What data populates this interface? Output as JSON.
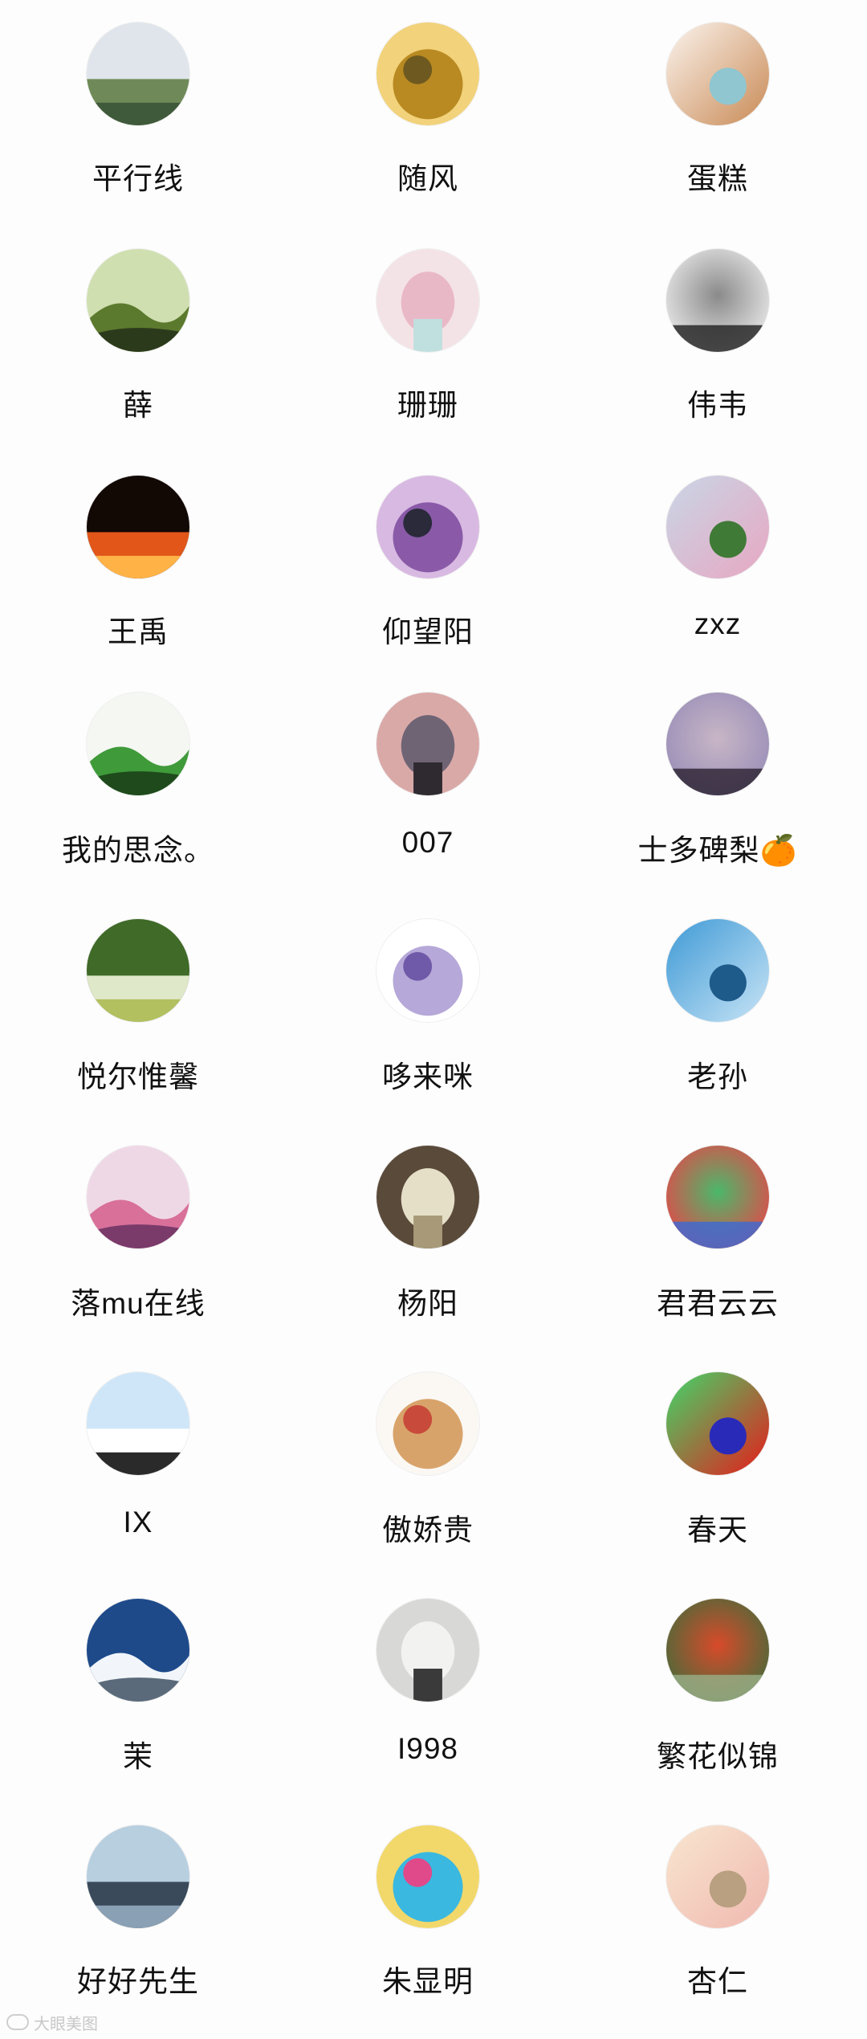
{
  "contacts": [
    {
      "name": "平行线",
      "icon": "pagoda-landscape-avatar",
      "colors": [
        "#dfe5ea",
        "#6f8a58",
        "#3f5a3a"
      ]
    },
    {
      "name": "随风",
      "icon": "golden-tree-avenue-avatar",
      "colors": [
        "#f2d27a",
        "#b98a22",
        "#6e5a20"
      ]
    },
    {
      "name": "蛋糕",
      "icon": "anime-catboy-avatar",
      "colors": [
        "#fbf4ee",
        "#c98a55",
        "#8fc6d0"
      ]
    },
    {
      "name": "薛",
      "icon": "river-valley-avatar",
      "colors": [
        "#cfdfb0",
        "#5c7a2d",
        "#2c3a1c"
      ]
    },
    {
      "name": "珊珊",
      "icon": "macaron-tower-avatar",
      "colors": [
        "#f4e3e6",
        "#e9b8c6",
        "#bfe0df"
      ]
    },
    {
      "name": "伟韦",
      "icon": "tie-suit-avatar",
      "colors": [
        "#e8e8e8",
        "#8a8a8a",
        "#1e1e1e"
      ]
    },
    {
      "name": "王禹",
      "icon": "fire-letter-v-avatar",
      "colors": [
        "#120804",
        "#e2561a",
        "#ffb347"
      ]
    },
    {
      "name": "仰望阳",
      "icon": "stage-child-avatar",
      "colors": [
        "#d8b9e2",
        "#8a5aa8",
        "#2a2a3a"
      ]
    },
    {
      "name": "zxz",
      "icon": "garden-tree-avatar",
      "colors": [
        "#c9d6e6",
        "#e7a7c2",
        "#3f7a36"
      ]
    },
    {
      "name": "我的思念。",
      "icon": "green-dinosaur-avatar",
      "colors": [
        "#f4f7f2",
        "#3f9a3a",
        "#1e4a1c"
      ]
    },
    {
      "name": "007",
      "icon": "sea-pier-sunset-avatar",
      "colors": [
        "#d9a9a8",
        "#6f6474",
        "#2e2a30"
      ]
    },
    {
      "name": "士多碑梨🍊",
      "icon": "portrait-woman-avatar",
      "colors": [
        "#9a8fb8",
        "#c8b6c6",
        "#2a2030"
      ]
    },
    {
      "name": "悦尔惟馨",
      "icon": "white-flowers-avatar",
      "colors": [
        "#3f6a28",
        "#dfe8c8",
        "#b2c060"
      ]
    },
    {
      "name": "哆来咪",
      "icon": "ribbon-bow-avatar",
      "colors": [
        "#ffffff",
        "#b6a8d8",
        "#6e5aa8"
      ]
    },
    {
      "name": "老孙",
      "icon": "sailboat-avatar",
      "colors": [
        "#3f9ad6",
        "#c8e4f6",
        "#1e5a8a"
      ]
    },
    {
      "name": "落mu在线",
      "icon": "pink-room-avatar",
      "colors": [
        "#efd8e6",
        "#d8709a",
        "#7a3a6a"
      ]
    },
    {
      "name": "杨阳",
      "icon": "child-dress-avatar",
      "colors": [
        "#5a4a3a",
        "#e6dfc8",
        "#a89a78"
      ]
    },
    {
      "name": "君君云云",
      "icon": "rainbow-piano-avatar",
      "colors": [
        "#e24a4a",
        "#4ab86a",
        "#3a6ad6"
      ]
    },
    {
      "name": "IX",
      "icon": "baby-seal-avatar",
      "colors": [
        "#cfe6f8",
        "#ffffff",
        "#2a2a2a"
      ]
    },
    {
      "name": "傲娇贵",
      "icon": "shiba-dog-avatar",
      "colors": [
        "#fbf8f4",
        "#d8a36a",
        "#c84a3a"
      ]
    },
    {
      "name": "春天",
      "icon": "heatmap-avatar",
      "colors": [
        "#3fd86a",
        "#e81a1a",
        "#2a2ab8"
      ]
    },
    {
      "name": "茉",
      "icon": "snow-mountain-avatar",
      "colors": [
        "#1e4a8a",
        "#f2f6fa",
        "#5a6a7a"
      ]
    },
    {
      "name": "I998",
      "icon": "princess-sketch-avatar",
      "colors": [
        "#d8d8d6",
        "#f2f2f0",
        "#3a3a3a"
      ]
    },
    {
      "name": "繁花似锦",
      "icon": "red-berries-avatar",
      "colors": [
        "#4a6a3a",
        "#d84a2a",
        "#9ab088"
      ]
    },
    {
      "name": "好好先生",
      "icon": "eiffel-tower-avatar",
      "colors": [
        "#b8cfe0",
        "#3a4a5a",
        "#8aa0b4"
      ]
    },
    {
      "name": "朱显明",
      "icon": "cartoon-characters-avatar",
      "colors": [
        "#f2d86a",
        "#3ab8e0",
        "#e04a8a"
      ]
    },
    {
      "name": "杏仁",
      "icon": "bunny-cartoon-avatar",
      "colors": [
        "#f8e6d0",
        "#f0b8b0",
        "#b8a080"
      ]
    }
  ],
  "watermark": {
    "text": "大眼美图",
    "icon": "watermark-logo-icon"
  }
}
